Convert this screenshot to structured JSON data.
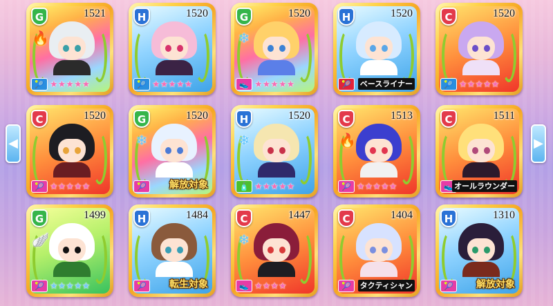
{
  "nav": {
    "prev_icon": "◀",
    "next_icon": "▶"
  },
  "role_icons": {
    "racket": "🎾",
    "shoe": "👟",
    "bottle": "🧴"
  },
  "cards": [
    {
      "rank": "G",
      "power": "1521",
      "element": "fire",
      "role": "racket",
      "stars": "★★★★★",
      "tag": "",
      "bg": "rainbow",
      "hair": "#e9eef2",
      "eye": "#3aa0a8",
      "outfit": "#2b2b2b"
    },
    {
      "rank": "H",
      "power": "1520",
      "element": "",
      "role": "racket",
      "stars": "★★★★★",
      "tag": "",
      "bg": "sky",
      "hair": "#f6bcd8",
      "eye": "#d8336b",
      "outfit": "#3b2345"
    },
    {
      "rank": "G",
      "power": "1520",
      "element": "ice",
      "role": "shoe",
      "stars": "★★★★★",
      "tag": "",
      "bg": "rainbow",
      "hair": "#ffd16a",
      "eye": "#3b82d6",
      "outfit": "#5b7fe8"
    },
    {
      "rank": "H",
      "power": "1520",
      "element": "",
      "role": "racket",
      "stars": "",
      "tag": "ベースライナー",
      "bg": "sky",
      "hair": "#d7ebff",
      "eye": "#5aa7e8",
      "outfit": "#ffffff"
    },
    {
      "rank": "C",
      "power": "1520",
      "element": "",
      "role": "racket",
      "stars": "★★★★★",
      "tag": "",
      "bg": "flame",
      "hair": "#c9a8f0",
      "eye": "#6b4fc9",
      "outfit": "#efe0f7"
    },
    {
      "rank": "C",
      "power": "1520",
      "element": "",
      "role": "racket",
      "stars": "★★★★★",
      "tag": "",
      "bg": "flame",
      "hair": "#1d1d22",
      "eye": "#e8a43a",
      "outfit": "#6a1d22"
    },
    {
      "rank": "G",
      "power": "1520",
      "element": "ice",
      "role": "racket",
      "stars": "",
      "tag": "解放対象",
      "bg": "rainbow",
      "hair": "#e8f2ff",
      "eye": "#4b7bd6",
      "outfit": "#ffffff"
    },
    {
      "rank": "H",
      "power": "1520",
      "element": "ice",
      "role": "bottle",
      "stars": "★★★★★",
      "tag": "",
      "bg": "sky",
      "hair": "#f5e6b0",
      "eye": "#c8324a",
      "outfit": "#2f2a6b"
    },
    {
      "rank": "C",
      "power": "1513",
      "element": "fire",
      "role": "racket",
      "stars": "★★★★★",
      "tag": "",
      "bg": "flame",
      "hair": "#3b3fcf",
      "eye": "#e2344f",
      "outfit": "#f1f1f1"
    },
    {
      "rank": "C",
      "power": "1511",
      "element": "",
      "role": "shoe",
      "stars": "",
      "tag": "オールラウンダー",
      "bg": "flame",
      "hair": "#ffe07a",
      "eye": "#b04a7a",
      "outfit": "#2c1a2c"
    },
    {
      "rank": "G",
      "power": "1499",
      "element": "wind",
      "role": "racket",
      "stars": "★★★★★",
      "tag": "",
      "bg": "green",
      "hair": "#ffffff",
      "eye": "#111111",
      "outfit": "#2f7d2f"
    },
    {
      "rank": "H",
      "power": "1484",
      "element": "",
      "role": "racket",
      "stars": "",
      "tag": "転生対象",
      "bg": "sky",
      "hair": "#8a5a3c",
      "eye": "#3a9fb6",
      "outfit": "#ffffff"
    },
    {
      "rank": "C",
      "power": "1447",
      "element": "ice",
      "role": "shoe",
      "stars": "★★★★",
      "tag": "",
      "bg": "flame",
      "hair": "#8a1d3a",
      "eye": "#d83a3a",
      "outfit": "#1d1d22"
    },
    {
      "rank": "C",
      "power": "1404",
      "element": "",
      "role": "racket",
      "stars": "",
      "tag": "タクティシャン",
      "bg": "flame",
      "hair": "#d7e2ff",
      "eye": "#7a8fe0",
      "outfit": "#f5e0ea"
    },
    {
      "rank": "H",
      "power": "1310",
      "element": "",
      "role": "racket",
      "stars": "",
      "tag": "解放対象",
      "bg": "sky",
      "hair": "#2a1e3a",
      "eye": "#2a9a6a",
      "outfit": "#7a2a1d"
    }
  ]
}
